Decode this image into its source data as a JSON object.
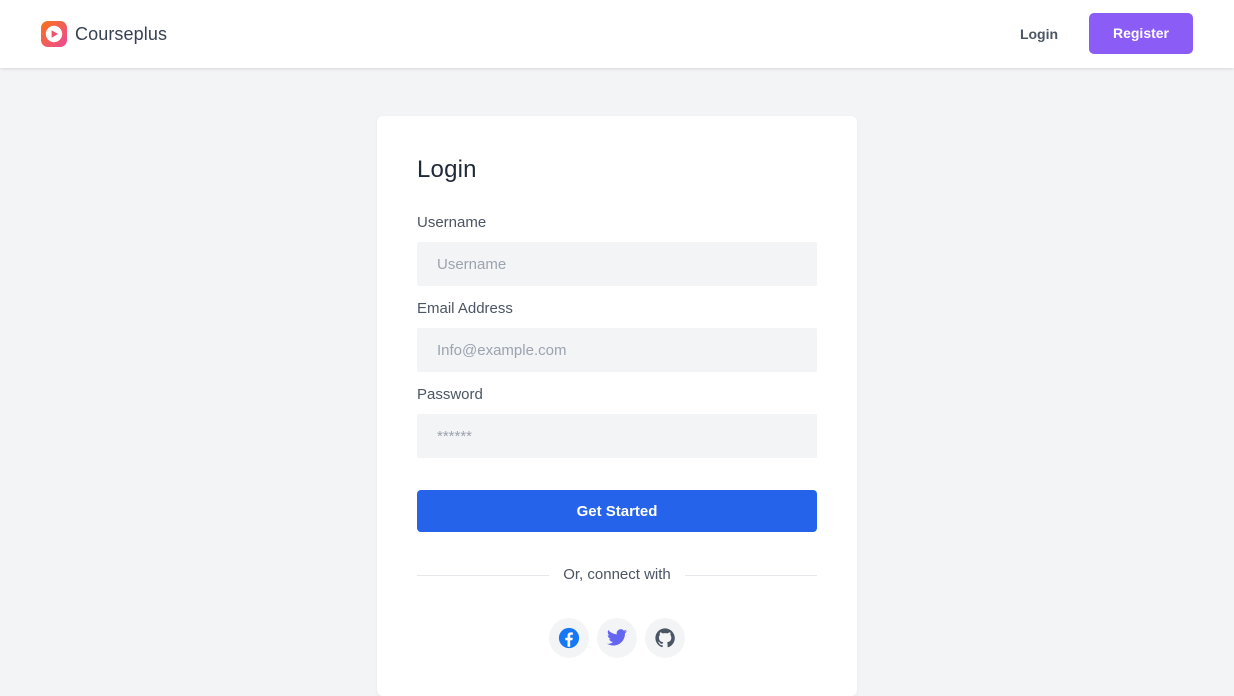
{
  "navbar": {
    "brand_name": "Courseplus",
    "login_label": "Login",
    "register_label": "Register"
  },
  "form": {
    "title": "Login",
    "username_label": "Username",
    "username_placeholder": "Username",
    "email_label": "Email Address",
    "email_placeholder": "Info@example.com",
    "password_label": "Password",
    "password_placeholder": "******",
    "submit_label": "Get Started",
    "divider_text": "Or, connect with"
  },
  "social": [
    {
      "icon": "facebook-icon",
      "color": "#1877f2"
    },
    {
      "icon": "twitter-icon",
      "color": "#6366f1"
    },
    {
      "icon": "github-icon",
      "color": "#4b5563"
    }
  ],
  "colors": {
    "accent": "#8b5cf6",
    "primary": "#2563eb",
    "page_background": "#f3f4f6"
  }
}
